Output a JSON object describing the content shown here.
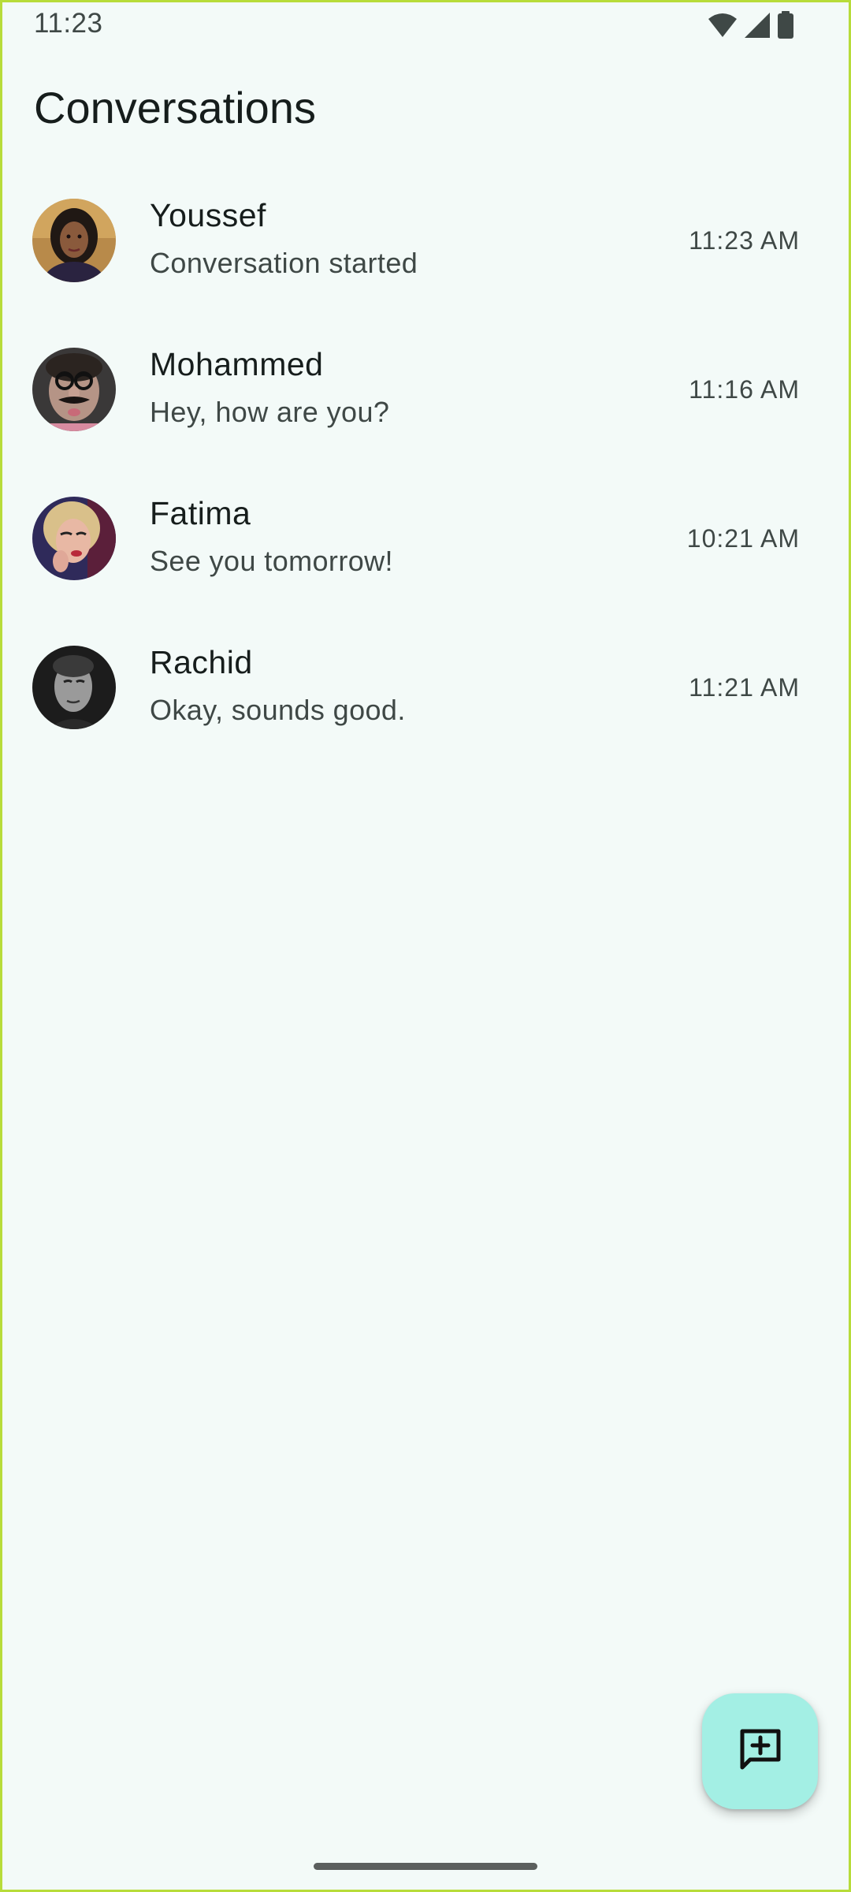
{
  "status_bar": {
    "time": "11:23",
    "icons": [
      "wifi-icon",
      "cellular-signal-icon",
      "battery-icon"
    ]
  },
  "page": {
    "title": "Conversations"
  },
  "conversations": [
    {
      "name": "Youssef",
      "preview": "Conversation started",
      "time": "11:23 AM",
      "avatar": "avatar-youssef"
    },
    {
      "name": "Mohammed",
      "preview": "Hey, how are you?",
      "time": "11:16 AM",
      "avatar": "avatar-mohammed"
    },
    {
      "name": "Fatima",
      "preview": "See you tomorrow!",
      "time": "10:21 AM",
      "avatar": "avatar-fatima"
    },
    {
      "name": "Rachid",
      "preview": "Okay, sounds good.",
      "time": "11:21 AM",
      "avatar": "avatar-rachid"
    }
  ],
  "fab": {
    "icon": "new-chat-icon"
  },
  "colors": {
    "background": "#f3faf8",
    "fab": "#a3efe4",
    "text_primary": "#161d1c",
    "text_secondary": "#3f4846"
  }
}
